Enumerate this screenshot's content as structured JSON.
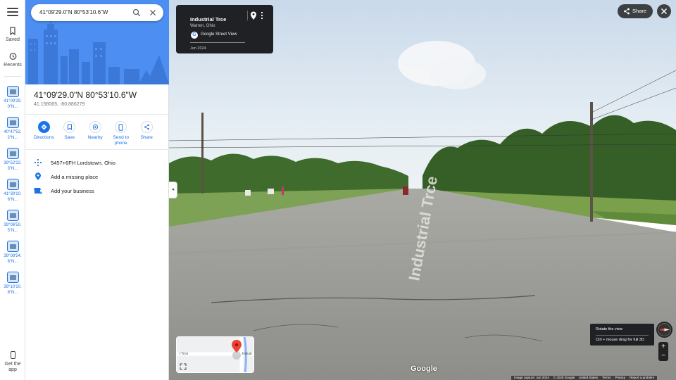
{
  "rail": {
    "saved_label": "Saved",
    "recents_label": "Recents",
    "recents": [
      {
        "label": "41°09'29.0\"N..."
      },
      {
        "label": "40°47'52.2\"N..."
      },
      {
        "label": "39°52'22.3\"N..."
      },
      {
        "label": "41°39'10.6\"N..."
      },
      {
        "label": "39°06'50.5\"N..."
      },
      {
        "label": "39°08'54.6\"N..."
      },
      {
        "label": "39°10'10.8\"N..."
      }
    ],
    "get_app_label": "Get the app"
  },
  "search": {
    "value": "41°09'29.0\"N 80°53'10.6\"W"
  },
  "place": {
    "title": "41°09'29.0\"N 80°53'10.6\"W",
    "decimal": "41.158065, -80.886279"
  },
  "actions": [
    {
      "label": "Directions",
      "icon": "directions-icon"
    },
    {
      "label": "Save",
      "icon": "bookmark-icon"
    },
    {
      "label": "Nearby",
      "icon": "nearby-icon"
    },
    {
      "label": "Send to phone",
      "icon": "phone-icon"
    },
    {
      "label": "Share",
      "icon": "share-icon"
    }
  ],
  "info_rows": [
    {
      "label": "5457+6FH Lordstown, Ohio",
      "icon": "plus-code-icon"
    },
    {
      "label": "Add a missing place",
      "icon": "add-place-icon"
    },
    {
      "label": "Add your business",
      "icon": "business-icon"
    }
  ],
  "streetview": {
    "road": "Industrial Trce",
    "city": "Warren, Ohio",
    "source": "Google Street View",
    "date": "Jun 2024",
    "share_label": "Share",
    "tooltip_title": "Rotate the view",
    "tooltip_hint": "Ctrl + mouse drag for full 3D",
    "minimap_label_left": "l Trce",
    "minimap_label_right": "Indust",
    "road_marking": "Industrial Trce",
    "google_mark": "Google",
    "footer": [
      "Image capture: Jun 2024",
      "© 2025 Google",
      "United States",
      "Terms",
      "Privacy",
      "Report a problem"
    ]
  },
  "colors": {
    "accent": "#1a73e8",
    "hero": "#4c8ef2",
    "dark": "#202124"
  }
}
